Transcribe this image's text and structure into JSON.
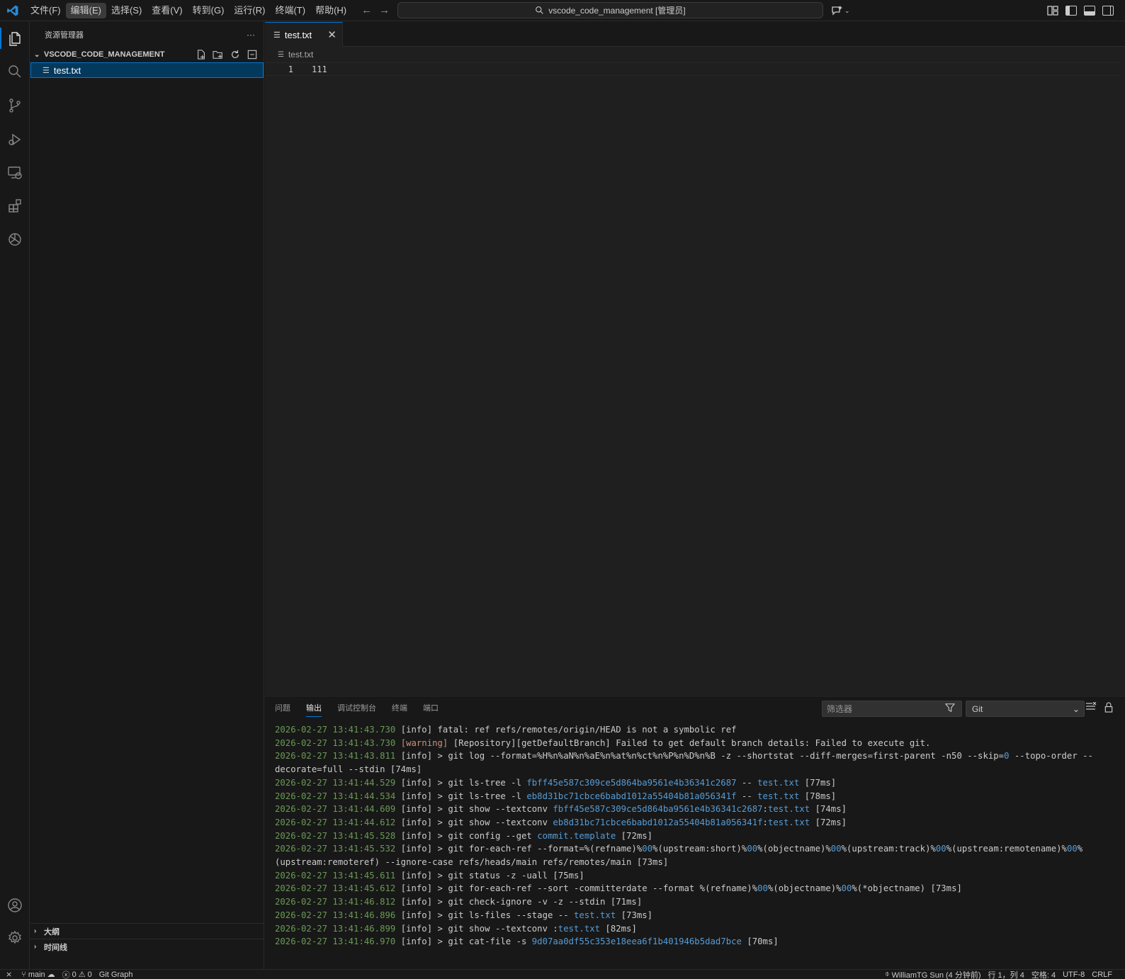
{
  "menu": [
    "文件(F)",
    "编辑(E)",
    "选择(S)",
    "查看(V)",
    "转到(G)",
    "运行(R)",
    "终端(T)",
    "帮助(H)"
  ],
  "command_center": {
    "text": "vscode_code_management [管理员]"
  },
  "sidebar": {
    "title": "资源管理器",
    "more": "···",
    "folder": "VSCODE_CODE_MANAGEMENT",
    "file": "test.txt",
    "outline": "大纲",
    "timeline": "时间线"
  },
  "editor": {
    "tab_label": "test.txt",
    "breadcrumb": "test.txt",
    "lines": [
      {
        "number": "1",
        "text": "111"
      }
    ]
  },
  "panel": {
    "tabs": [
      "问题",
      "输出",
      "调试控制台",
      "终端",
      "端口"
    ],
    "active_tab": "输出",
    "filter_placeholder": "筛选器",
    "channel": "Git"
  },
  "output_log": [
    [
      {
        "t": "ts",
        "v": "2026-02-27 13:41:43.730"
      },
      {
        "t": "p",
        "v": " "
      },
      {
        "t": "lvl",
        "v": "[info]"
      },
      {
        "t": "p",
        "v": " fatal: ref refs/remotes/origin/HEAD is not a symbolic ref"
      }
    ],
    [
      {
        "t": "ts",
        "v": "2026-02-27 13:41:43.730"
      },
      {
        "t": "p",
        "v": " "
      },
      {
        "t": "warn",
        "v": "[warning]"
      },
      {
        "t": "p",
        "v": " [Repository][getDefaultBranch] Failed to get default branch details: Failed to execute git."
      }
    ],
    [
      {
        "t": "ts",
        "v": "2026-02-27 13:41:43.811"
      },
      {
        "t": "p",
        "v": " "
      },
      {
        "t": "lvl",
        "v": "[info]"
      },
      {
        "t": "p",
        "v": " > git log --format=%H%n%aN%n%aE%n%at%n%ct%n%P%n%D%n%B -z --shortstat --diff-merges=first-parent -n50 --skip="
      },
      {
        "t": "hl",
        "v": "0"
      },
      {
        "t": "p",
        "v": " --topo-order --decorate=full --stdin [74ms]"
      }
    ],
    [
      {
        "t": "ts",
        "v": "2026-02-27 13:41:44.529"
      },
      {
        "t": "p",
        "v": " "
      },
      {
        "t": "lvl",
        "v": "[info]"
      },
      {
        "t": "p",
        "v": " > git ls-tree -l "
      },
      {
        "t": "hl",
        "v": "fbff45e587c309ce5d864ba9561e4b36341c2687"
      },
      {
        "t": "p",
        "v": " -- "
      },
      {
        "t": "hl",
        "v": "test.txt"
      },
      {
        "t": "p",
        "v": " [77ms]"
      }
    ],
    [
      {
        "t": "ts",
        "v": "2026-02-27 13:41:44.534"
      },
      {
        "t": "p",
        "v": " "
      },
      {
        "t": "lvl",
        "v": "[info]"
      },
      {
        "t": "p",
        "v": " > git ls-tree -l "
      },
      {
        "t": "hl",
        "v": "eb8d31bc71cbce6babd1012a55404b81a056341f"
      },
      {
        "t": "p",
        "v": " -- "
      },
      {
        "t": "hl",
        "v": "test.txt"
      },
      {
        "t": "p",
        "v": " [78ms]"
      }
    ],
    [
      {
        "t": "ts",
        "v": "2026-02-27 13:41:44.609"
      },
      {
        "t": "p",
        "v": " "
      },
      {
        "t": "lvl",
        "v": "[info]"
      },
      {
        "t": "p",
        "v": " > git show --textconv "
      },
      {
        "t": "hl",
        "v": "fbff45e587c309ce5d864ba9561e4b36341c2687"
      },
      {
        "t": "p",
        "v": ":"
      },
      {
        "t": "hl",
        "v": "test.txt"
      },
      {
        "t": "p",
        "v": " [74ms]"
      }
    ],
    [
      {
        "t": "ts",
        "v": "2026-02-27 13:41:44.612"
      },
      {
        "t": "p",
        "v": " "
      },
      {
        "t": "lvl",
        "v": "[info]"
      },
      {
        "t": "p",
        "v": " > git show --textconv "
      },
      {
        "t": "hl",
        "v": "eb8d31bc71cbce6babd1012a55404b81a056341f"
      },
      {
        "t": "p",
        "v": ":"
      },
      {
        "t": "hl",
        "v": "test.txt"
      },
      {
        "t": "p",
        "v": " [72ms]"
      }
    ],
    [
      {
        "t": "ts",
        "v": "2026-02-27 13:41:45.528"
      },
      {
        "t": "p",
        "v": " "
      },
      {
        "t": "lvl",
        "v": "[info]"
      },
      {
        "t": "p",
        "v": " > git config --get "
      },
      {
        "t": "hl",
        "v": "commit.template"
      },
      {
        "t": "p",
        "v": " [72ms]"
      }
    ],
    [
      {
        "t": "ts",
        "v": "2026-02-27 13:41:45.532"
      },
      {
        "t": "p",
        "v": " "
      },
      {
        "t": "lvl",
        "v": "[info]"
      },
      {
        "t": "p",
        "v": " > git for-each-ref --format=%(refname)%"
      },
      {
        "t": "hl",
        "v": "00"
      },
      {
        "t": "p",
        "v": "%(upstream:short)%"
      },
      {
        "t": "hl",
        "v": "00"
      },
      {
        "t": "p",
        "v": "%(objectname)%"
      },
      {
        "t": "hl",
        "v": "00"
      },
      {
        "t": "p",
        "v": "%(upstream:track)%"
      },
      {
        "t": "hl",
        "v": "00"
      },
      {
        "t": "p",
        "v": "%(upstream:remotename)%"
      },
      {
        "t": "hl",
        "v": "00"
      },
      {
        "t": "p",
        "v": "%(upstream:remoteref) --ignore-case refs/heads/main refs/remotes/main [73ms]"
      }
    ],
    [
      {
        "t": "ts",
        "v": "2026-02-27 13:41:45.611"
      },
      {
        "t": "p",
        "v": " "
      },
      {
        "t": "lvl",
        "v": "[info]"
      },
      {
        "t": "p",
        "v": " > git status -z -uall [75ms]"
      }
    ],
    [
      {
        "t": "ts",
        "v": "2026-02-27 13:41:45.612"
      },
      {
        "t": "p",
        "v": " "
      },
      {
        "t": "lvl",
        "v": "[info]"
      },
      {
        "t": "p",
        "v": " > git for-each-ref --sort -committerdate --format %(refname)%"
      },
      {
        "t": "hl",
        "v": "00"
      },
      {
        "t": "p",
        "v": "%(objectname)%"
      },
      {
        "t": "hl",
        "v": "00"
      },
      {
        "t": "p",
        "v": "%(*objectname) [73ms]"
      }
    ],
    [
      {
        "t": "ts",
        "v": "2026-02-27 13:41:46.812"
      },
      {
        "t": "p",
        "v": " "
      },
      {
        "t": "lvl",
        "v": "[info]"
      },
      {
        "t": "p",
        "v": " > git check-ignore -v -z --stdin [71ms]"
      }
    ],
    [
      {
        "t": "ts",
        "v": "2026-02-27 13:41:46.896"
      },
      {
        "t": "p",
        "v": " "
      },
      {
        "t": "lvl",
        "v": "[info]"
      },
      {
        "t": "p",
        "v": " > git ls-files --stage -- "
      },
      {
        "t": "hl",
        "v": "test.txt"
      },
      {
        "t": "p",
        "v": " [73ms]"
      }
    ],
    [
      {
        "t": "ts",
        "v": "2026-02-27 13:41:46.899"
      },
      {
        "t": "p",
        "v": " "
      },
      {
        "t": "lvl",
        "v": "[info]"
      },
      {
        "t": "p",
        "v": " > git show --textconv :"
      },
      {
        "t": "hl",
        "v": "test.txt"
      },
      {
        "t": "p",
        "v": " [82ms]"
      }
    ],
    [
      {
        "t": "ts",
        "v": "2026-02-27 13:41:46.970"
      },
      {
        "t": "p",
        "v": " "
      },
      {
        "t": "lvl",
        "v": "[info]"
      },
      {
        "t": "p",
        "v": " > git cat-file -s "
      },
      {
        "t": "hl",
        "v": "9d07aa0df55c353e18eea6f1b401946b5dad7bce"
      },
      {
        "t": "p",
        "v": " [70ms]"
      }
    ]
  ],
  "statusbar": {
    "branch": "main",
    "errors": "0",
    "warnings": "0",
    "git_graph": "Git Graph",
    "blame": "WilliamTG Sun (4 分钟前)",
    "position": "行 1，列 4",
    "spaces": "空格: 4",
    "encoding": "UTF-8",
    "eol": "CRLF"
  },
  "colors": {
    "accent": "#0078d4",
    "selection": "#04395e",
    "timestamp": "#6a9955",
    "warning": "#ce9178",
    "link": "#569cd6"
  },
  "icons": [
    "vscode-logo-icon",
    "explorer-icon",
    "search-icon",
    "source-control-icon",
    "run-debug-icon",
    "remote-explorer-icon",
    "extensions-icon",
    "chatgpt-icon",
    "account-icon",
    "settings-gear-icon"
  ]
}
